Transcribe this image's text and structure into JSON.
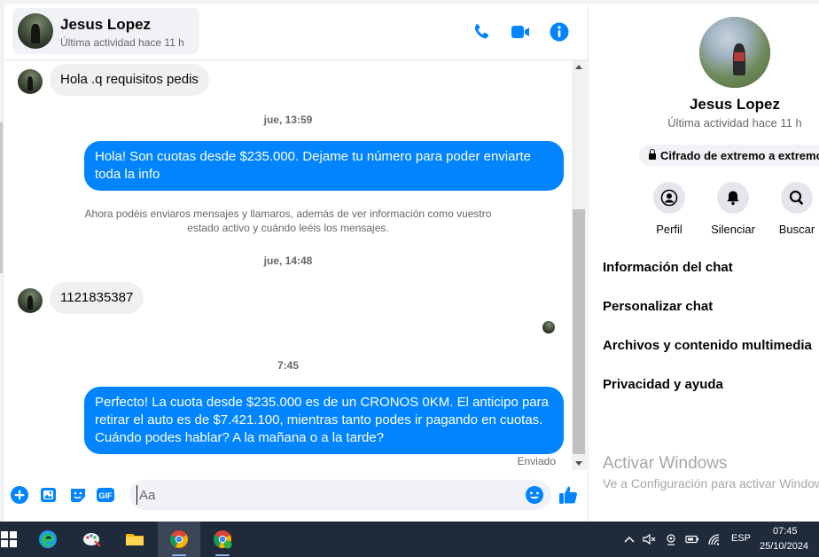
{
  "colors": {
    "accent": "#0084ff",
    "incoming_bubble": "#f0f0f0",
    "secondary_text": "#65676b",
    "taskbar": "#1f2a3a"
  },
  "header": {
    "name": "Jesus Lopez",
    "status": "Última actividad hace 11 h",
    "icons": [
      "phone-icon",
      "video-camera-icon",
      "info-icon"
    ]
  },
  "messages": {
    "m1": "Hola .q requisitos pedis",
    "t1": "jue, 13:59",
    "m2": "Hola! Son cuotas desde $235.000. Dejame tu número para poder enviarte toda la info",
    "note": "Ahora podéis enviaros mensajes y llamaros, además de ver información como vuestro estado activo y cuándo leéis los mensajes.",
    "t2": "jue, 14:48",
    "m3": "1121835387",
    "t3": "7:45",
    "m4": "Perfecto! La cuota desde $235.000 es de un CRONOS 0KM. El anticipo para retirar el auto es de $7.421.100, mientras tanto podes ir pagando en cuotas. Cuándo podes hablar? A la mañana o a la tarde?",
    "sent": "Enviado"
  },
  "composer": {
    "placeholder": "Aa",
    "icons": [
      "plus-icon",
      "image-icon",
      "sticker-icon",
      "gif-icon",
      "emoji-icon",
      "thumbs-up-icon"
    ]
  },
  "right_panel": {
    "name": "Jesus Lopez",
    "status": "Última actividad hace 11 h",
    "encryption": "Cifrado de extremo a extremo",
    "actions": {
      "profile": "Perfil",
      "mute": "Silenciar",
      "search": "Buscar"
    },
    "menu": {
      "info": "Información del chat",
      "customize": "Personalizar chat",
      "media": "Archivos y contenido multimedia",
      "privacy": "Privacidad y ayuda"
    },
    "watermark_title": "Activar Windows",
    "watermark_sub": "Ve a Configuración para activar Windows."
  },
  "taskbar": {
    "lang": "ESP",
    "time": "07:45",
    "date": "25/10/2024"
  }
}
